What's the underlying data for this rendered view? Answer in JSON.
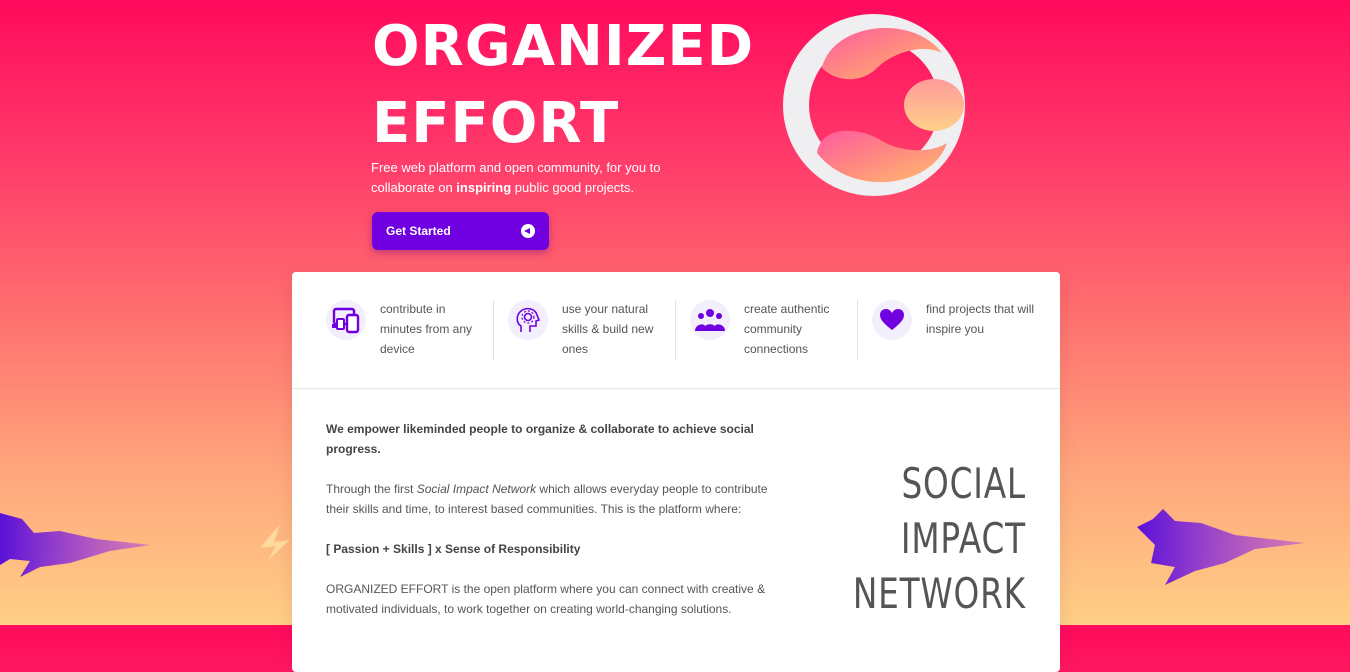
{
  "hero": {
    "title_line1": "ORGANIZED",
    "title_line2": "EFFORT",
    "subtitle_before": "Free web platform and open community, for you to collaborate on ",
    "subtitle_bold": "inspiring",
    "subtitle_after": " public good projects.",
    "cta_label": "Get Started"
  },
  "features": [
    {
      "icon": "devices-icon",
      "text": "contribute in minutes from any device"
    },
    {
      "icon": "mind-gear-icon",
      "text": "use your natural skills & build new ones"
    },
    {
      "icon": "people-group-icon",
      "text": "create authentic community connections"
    },
    {
      "icon": "heart-icon",
      "text": "find projects that will inspire you"
    }
  ],
  "about": {
    "lead": "We empower likeminded people to organize & collaborate to achieve social progress.",
    "p2_before": "Through the first ",
    "p2_italic": "Social Impact Network",
    "p2_after": " which allows everyday people to contribute their skills and time, to interest based communities. This is the platform where:",
    "formula": "[ Passion + Skills ] x Sense of Responsibility",
    "p4": "ORGANIZED EFFORT is the open platform where you can connect with creative & motivated individuals, to work together on creating world-changing solutions."
  },
  "side_heading": {
    "line1": "SOCIAL",
    "line2": "IMPACT",
    "line3": "NETWORK"
  },
  "colors": {
    "accent": "#7000e0",
    "gradient_top": "#ff0a5c",
    "gradient_bottom": "#ffcf86"
  }
}
